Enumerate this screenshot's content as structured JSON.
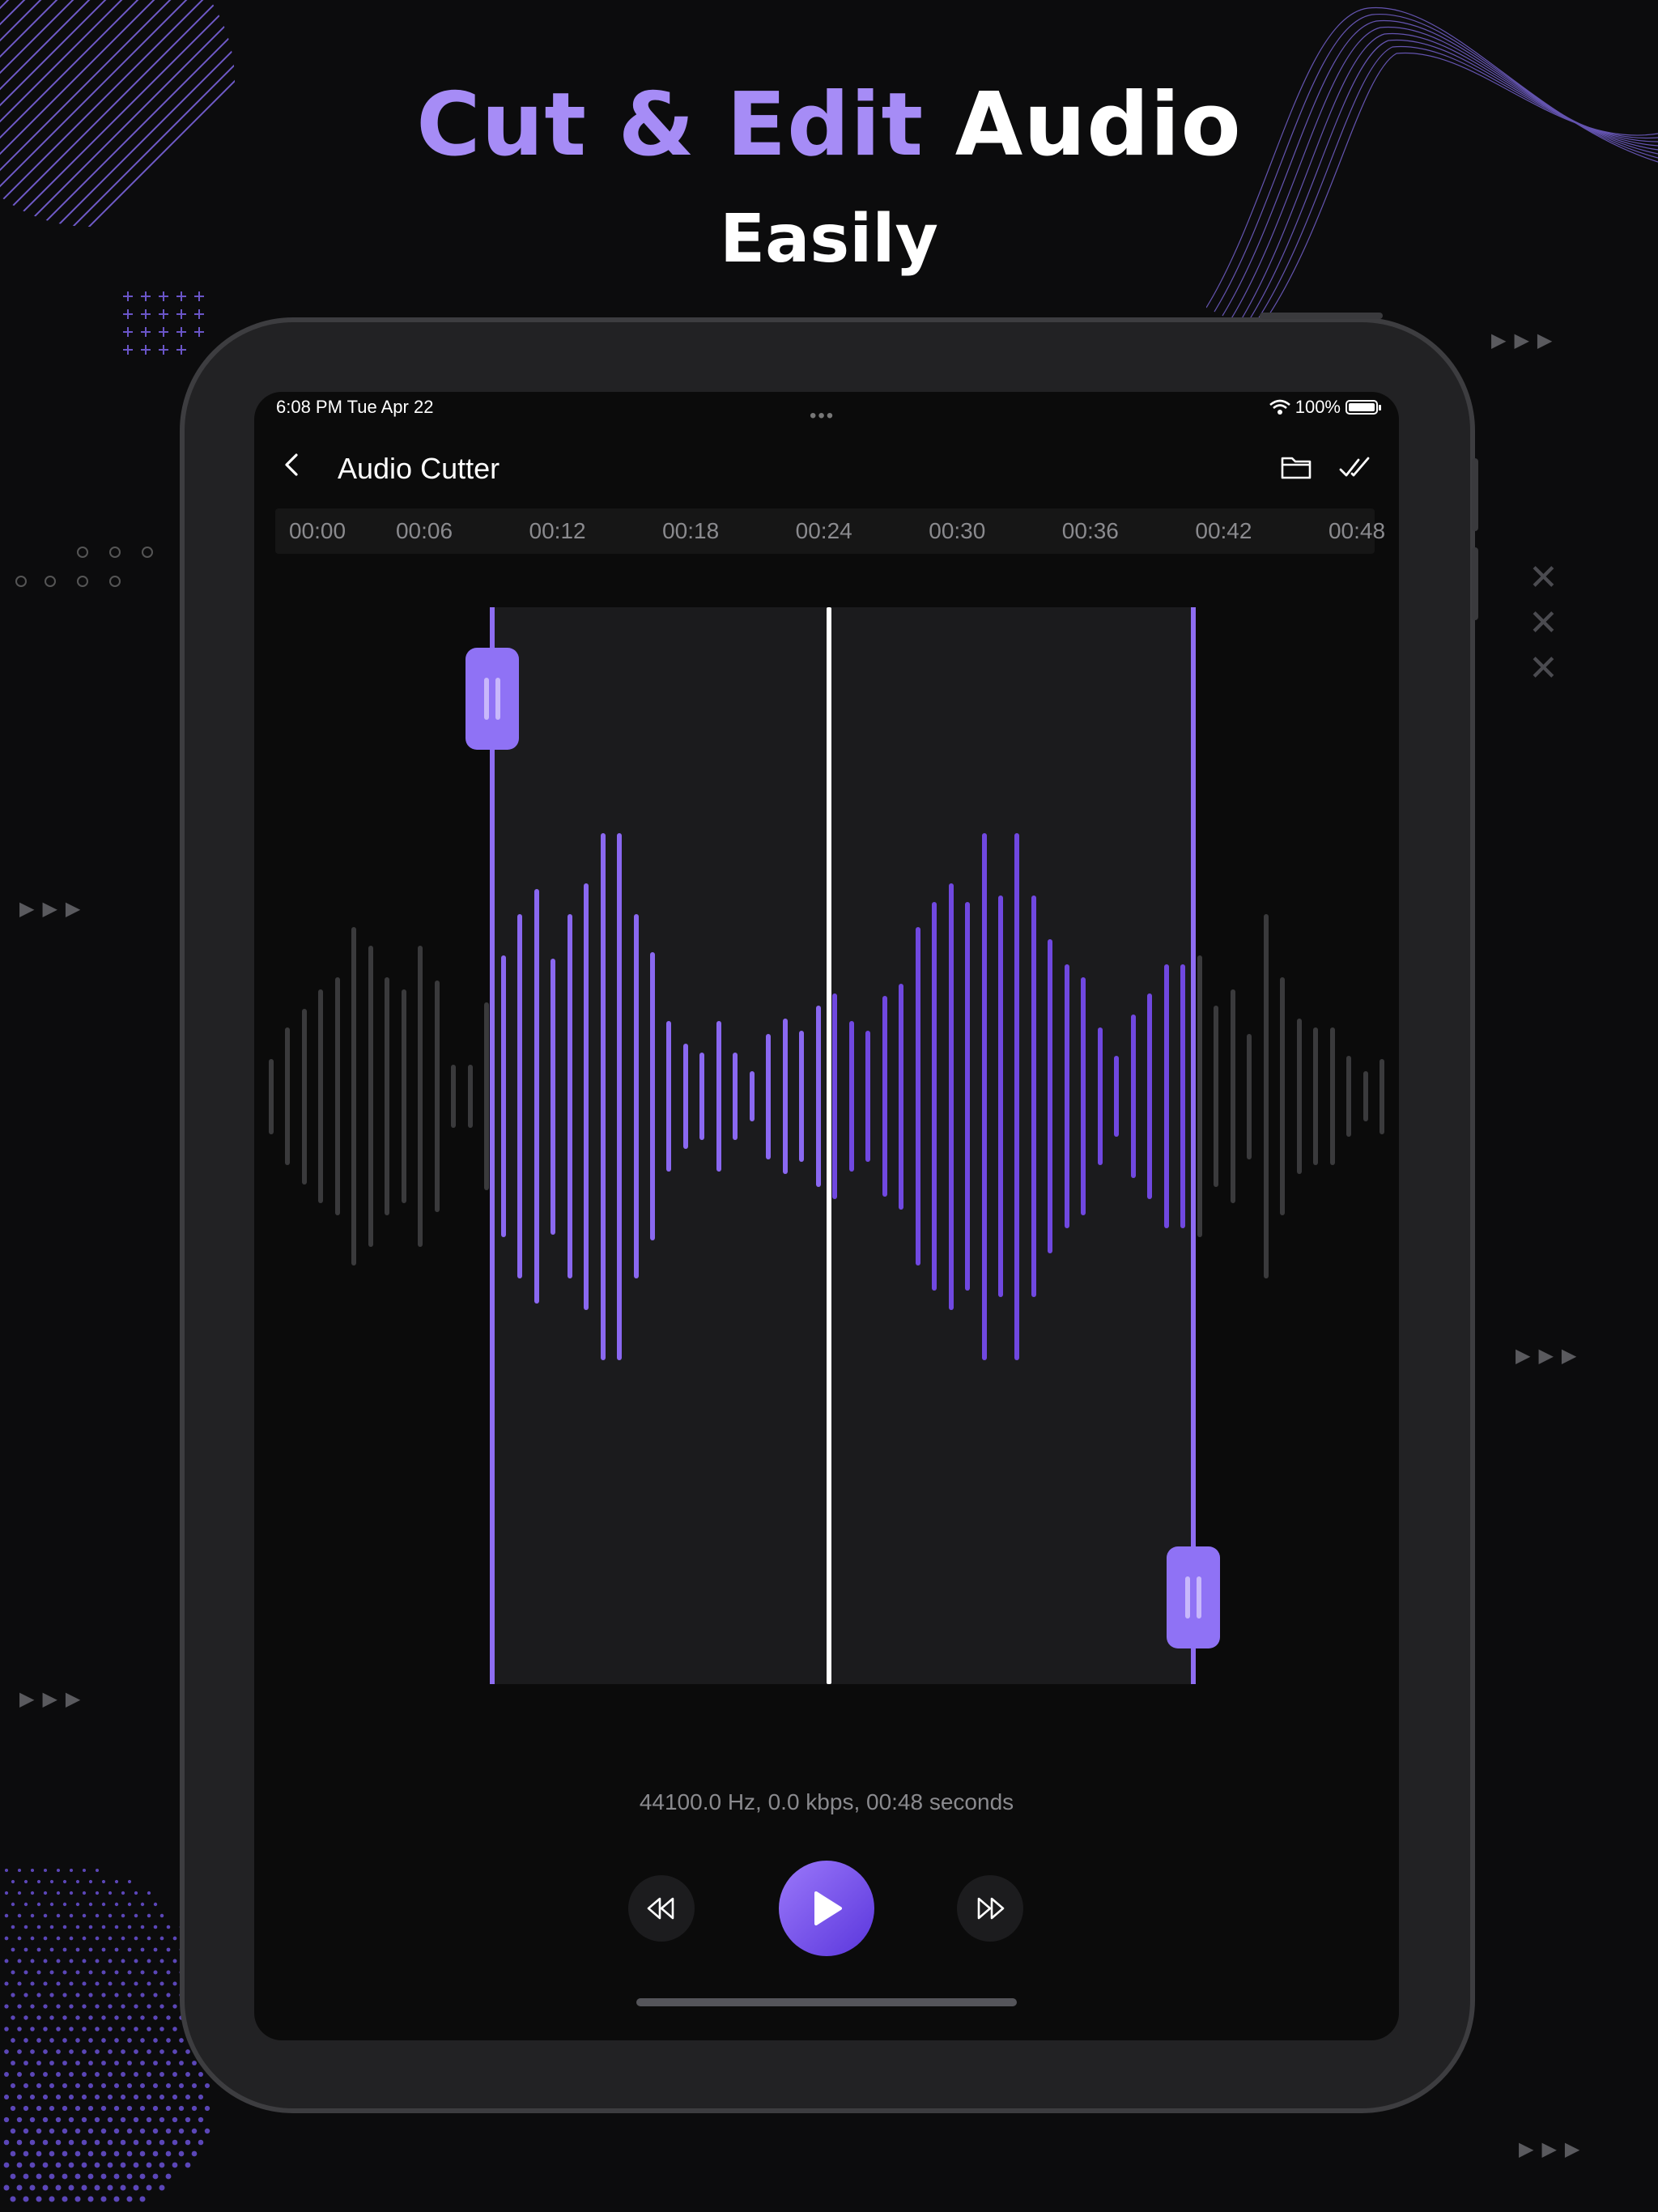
{
  "headline": {
    "line1_accent": "Cut & Edit",
    "line1_rest": "Audio",
    "line2": "Easily"
  },
  "status_bar": {
    "time": "6:08 PM   Tue Apr 22",
    "battery": "100%"
  },
  "nav": {
    "title": "Audio Cutter",
    "icons": [
      "back-chevron-icon",
      "folder-icon",
      "double-check-icon"
    ]
  },
  "timeline": {
    "ticks": [
      "00:00",
      "00:06",
      "00:12",
      "00:18",
      "00:24",
      "00:30",
      "00:36",
      "00:42",
      "00:48"
    ]
  },
  "selection": {
    "start_fraction": 0.2,
    "end_fraction": 0.82,
    "playhead_fraction": 0.5
  },
  "waveform": {
    "amplitudes": [
      0.3,
      0.55,
      0.7,
      0.85,
      0.95,
      1.35,
      1.2,
      0.95,
      0.85,
      1.2,
      0.92,
      0.25,
      0.25,
      0.75,
      1.12,
      1.45,
      1.65,
      1.1,
      1.45,
      1.7,
      2.1,
      2.1,
      1.45,
      1.15,
      0.6,
      0.42,
      0.35,
      0.6,
      0.35,
      0.2,
      0.5,
      0.62,
      0.52,
      0.72,
      0.82,
      0.6,
      0.52,
      0.8,
      0.9,
      1.35,
      1.55,
      1.7,
      1.55,
      2.1,
      1.6,
      2.1,
      1.6,
      1.25,
      1.05,
      0.95,
      0.55,
      0.32,
      0.65,
      0.82,
      1.05,
      1.05,
      1.12,
      0.72,
      0.85,
      0.5,
      1.45,
      0.95,
      0.62,
      0.55,
      0.55,
      0.32,
      0.2,
      0.3
    ]
  },
  "audio_info": "44100.0 Hz, 0.0 kbps, 00:48 seconds",
  "controls": {
    "rewind": "rewind-icon",
    "play": "play-icon",
    "forward": "fast-forward-icon"
  }
}
